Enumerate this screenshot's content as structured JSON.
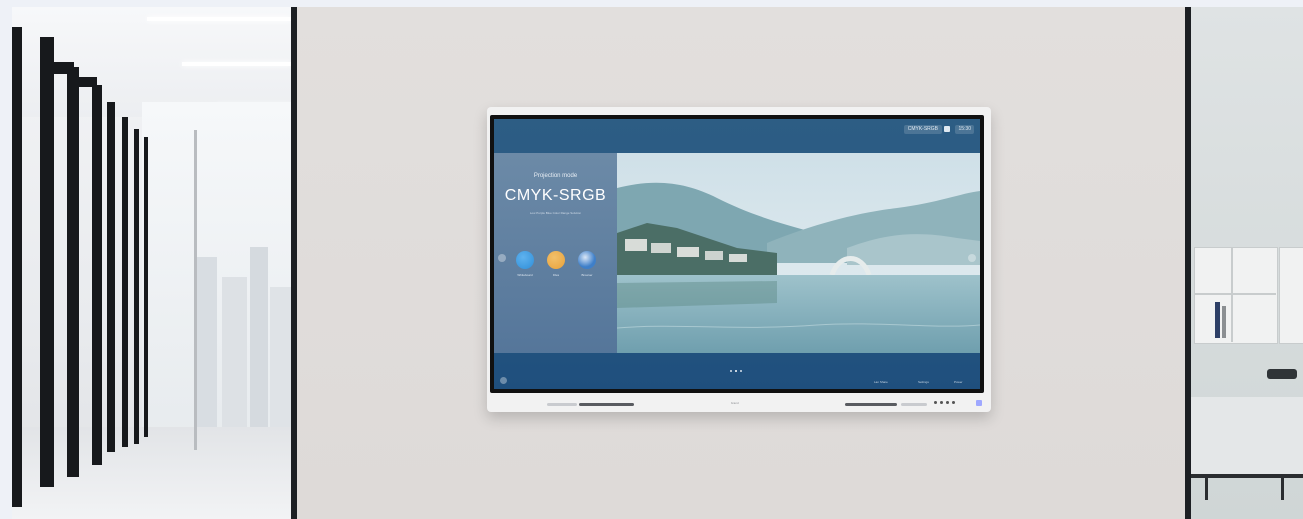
{
  "scene": {
    "wall_color": "#dfdcda",
    "frame_color": "#1c1f23",
    "page_background": "#eef1f7"
  },
  "display": {
    "topbar": {
      "badge": "CMYK-SRGB",
      "time": "15:30"
    },
    "mode_label": "Projection mode",
    "mode_value": "CMYK-SRGB",
    "mode_subtitle": "Low Purple Blue Color Range Solution",
    "apps": [
      {
        "label": "Whiteboard",
        "icon": "pen-app-icon",
        "color": "#2f8ed8"
      },
      {
        "label": "Files",
        "icon": "folder-app-icon",
        "color": "#e8a13a"
      },
      {
        "label": "Browser",
        "icon": "globe-app-icon",
        "color": "#3e7fc9"
      }
    ],
    "bottom_items": [
      {
        "label": "Lan Share",
        "icon": "share-icon"
      },
      {
        "label": "Settings",
        "icon": "gear-icon"
      },
      {
        "label": "Power",
        "icon": "power-icon"
      }
    ],
    "brand": "brand",
    "page_dots": 3,
    "active_dot": 1
  }
}
